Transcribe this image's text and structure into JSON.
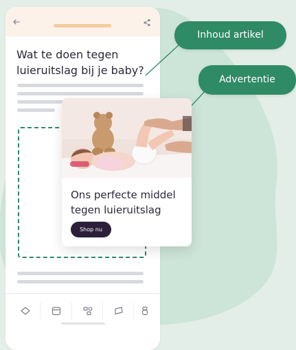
{
  "colors": {
    "background": "#e2eee7",
    "blob": "#cde4d8",
    "accent_green": "#2f8a66",
    "topbar": "#fdf2ea",
    "urlbar": "#f6cb9c",
    "button_dark": "#2c1f3a",
    "text_dark": "#2c2838"
  },
  "phone": {
    "topbar": {
      "back_icon": "arrow-left-icon",
      "share_icon": "share-icon"
    },
    "article": {
      "headline": "Wat te doen tegen luieruitslag bij je baby?"
    },
    "bottom_nav": {
      "items": [
        {
          "icon": "home-icon"
        },
        {
          "icon": "calendar-icon"
        },
        {
          "icon": "tools-icon"
        },
        {
          "icon": "chat-icon"
        },
        {
          "icon": "baby-bottle-icon"
        }
      ]
    }
  },
  "ad": {
    "image": "baby-photo",
    "title": "Ons perfecte middel tegen luieruitslag",
    "button_label": "Shop nu"
  },
  "callouts": {
    "content_label": "Inhoud artikel",
    "ad_label": "Advertentie"
  }
}
